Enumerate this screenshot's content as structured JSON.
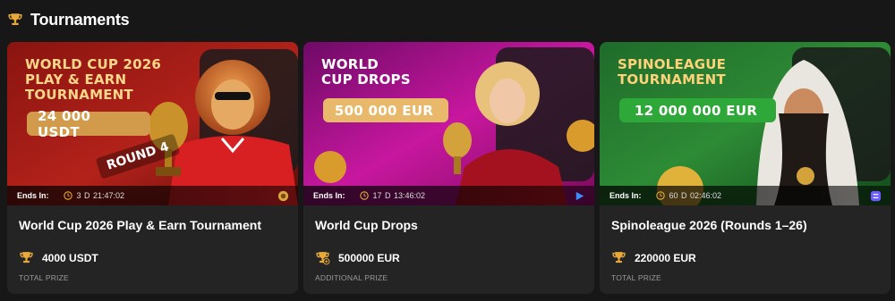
{
  "section": {
    "title": "Tournaments",
    "icon": "trophy-icon"
  },
  "colors": {
    "accent": "#e8a93b",
    "card_bg": "#242424",
    "page_bg": "#171717"
  },
  "cards": [
    {
      "banner_title": "WORLD CUP 2026\nPLAY & EARN\nTOURNAMENT",
      "banner_amount": "24 000 USDT",
      "banner_extra": "ROUND 4",
      "ends_label": "Ends In:",
      "ends_time": "3 D 21:47:02",
      "provider_icon": "lion-icon",
      "name": "World Cup 2026 Play & Earn Tournament",
      "prize_icon": "trophy-icon",
      "prize_amount": "4000 USDT",
      "prize_label": "TOTAL PRIZE"
    },
    {
      "banner_title": "WORLD\nCUP DROPS",
      "banner_amount": "500 000 EUR",
      "ends_label": "Ends In:",
      "ends_time": "17 D 13:46:02",
      "provider_icon": "play-provider-icon",
      "name": "World Cup Drops",
      "prize_icon": "trophy-plus-icon",
      "prize_amount": "500000 EUR",
      "prize_label": "ADDITIONAL PRIZE"
    },
    {
      "banner_title": "SPINOLEAGUE\nTOURNAMENT",
      "banner_amount": "12 000 000 EUR",
      "ends_label": "Ends In:",
      "ends_time": "60 D 02:46:02",
      "provider_icon": "spinomenal-icon",
      "name": "Spinoleague 2026 (Rounds 1–26)",
      "prize_icon": "trophy-icon",
      "prize_amount": "220000 EUR",
      "prize_label": "TOTAL PRIZE"
    }
  ]
}
